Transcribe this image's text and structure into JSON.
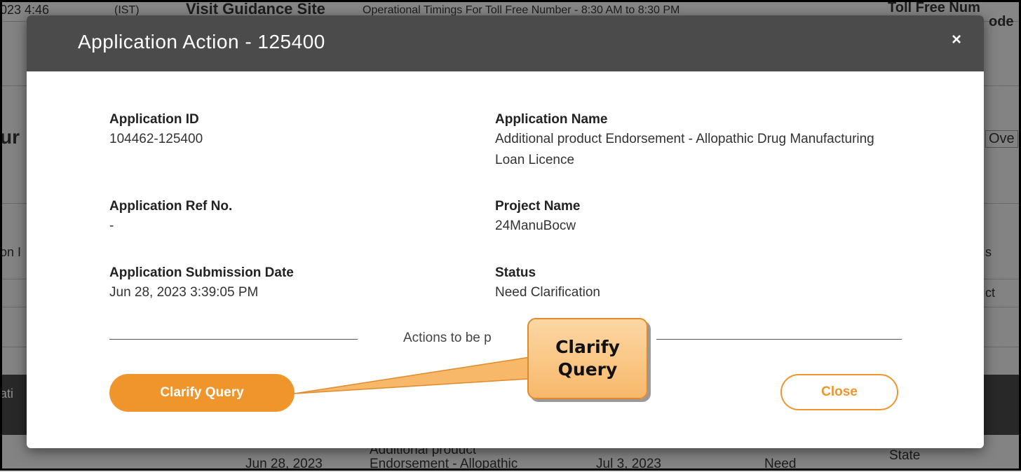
{
  "background": {
    "top_left": "023 4:46",
    "top_time_zone": "(IST)",
    "visit_site": "Visit Guidance Site",
    "timings": "Operational Timings For Toll Free Number - 8:30 AM to 8:30 PM",
    "toll_free": "Toll Free Num",
    "code_fragment": "ode",
    "section_fragment": "ur",
    "over_fragment": "Ove",
    "left_row_fragment": "on I",
    "right_row_fragment": "s",
    "select_fragment": "ct",
    "header_left_fragment": "ati",
    "row_col_date1": "Jun 28, 2023",
    "row_col_product_1": "Additional product",
    "row_col_product_2": "Endorsement - Allopathic",
    "row_col_date2": "Jul 3, 2023",
    "row_col_status": "Need",
    "row_col_state": "State"
  },
  "modal": {
    "title": "Application Action - 125400",
    "close_icon": "×",
    "fields": {
      "app_id_label": "Application ID",
      "app_id_value": "104462-125400",
      "app_name_label": "Application Name",
      "app_name_value": "Additional product Endorsement - Allopathic Drug Manufacturing Loan Licence",
      "ref_label": "Application Ref No.",
      "ref_value": "-",
      "project_label": "Project Name",
      "project_value": "24ManuBocw",
      "submission_label": "Application Submission Date",
      "submission_value": "Jun 28, 2023 3:39:05 PM",
      "status_label": "Status",
      "status_value": "Need Clarification"
    },
    "divider_text": "Actions to be p",
    "clarify_button": "Clarify Query",
    "close_button": "Close"
  },
  "callout": {
    "text": "Clarify\nQuery"
  },
  "colors": {
    "accent": "#f0952c",
    "header": "#4b4b4b"
  }
}
